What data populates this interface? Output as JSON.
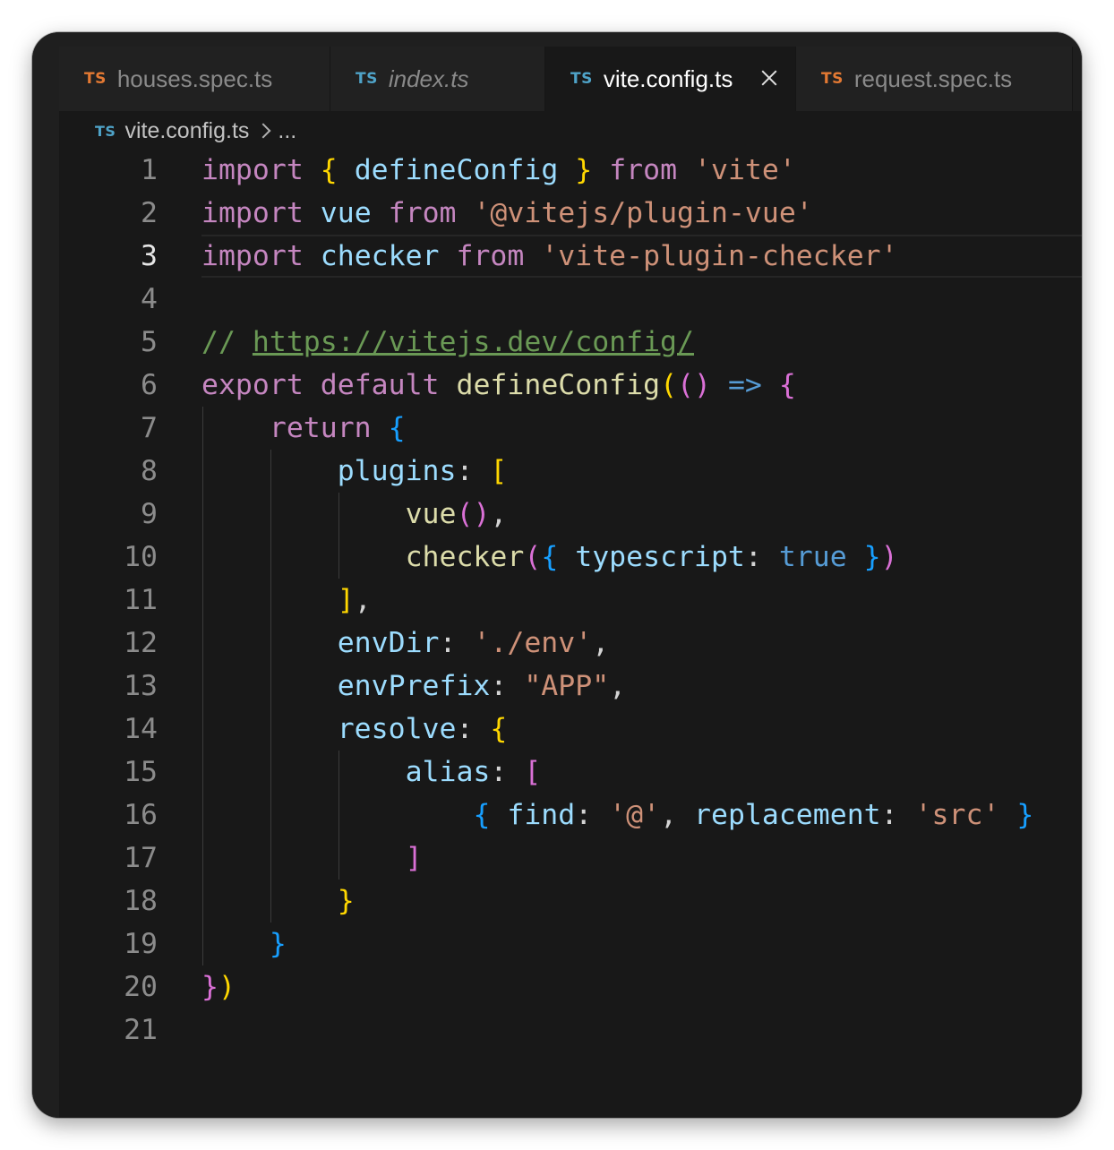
{
  "tabs": [
    {
      "badge": "TS",
      "label": "houses.spec.ts",
      "badge_color": "#e37933",
      "active": false,
      "italic": false
    },
    {
      "badge": "TS",
      "label": "index.ts",
      "badge_color": "#4fa3c8",
      "active": false,
      "italic": true
    },
    {
      "badge": "TS",
      "label": "vite.config.ts",
      "badge_color": "#4fa3c8",
      "active": true,
      "italic": false
    },
    {
      "badge": "TS",
      "label": "request.spec.ts",
      "badge_color": "#e37933",
      "active": false,
      "italic": false
    }
  ],
  "breadcrumb": {
    "badge": "TS",
    "file": "vite.config.ts",
    "more": "..."
  },
  "editor": {
    "current_line": 3,
    "line_numbers": [
      "1",
      "2",
      "3",
      "4",
      "5",
      "6",
      "7",
      "8",
      "9",
      "10",
      "11",
      "12",
      "13",
      "14",
      "15",
      "16",
      "17",
      "18",
      "19",
      "20",
      "21"
    ],
    "lines": [
      [
        [
          "kw",
          "import"
        ],
        [
          "pn",
          " "
        ],
        [
          "b1",
          "{"
        ],
        [
          "pn",
          " "
        ],
        [
          "vr",
          "defineConfig"
        ],
        [
          "pn",
          " "
        ],
        [
          "b1",
          "}"
        ],
        [
          "pn",
          " "
        ],
        [
          "kw",
          "from"
        ],
        [
          "pn",
          " "
        ],
        [
          "st",
          "'vite'"
        ]
      ],
      [
        [
          "kw",
          "import"
        ],
        [
          "pn",
          " "
        ],
        [
          "vr",
          "vue"
        ],
        [
          "pn",
          " "
        ],
        [
          "kw",
          "from"
        ],
        [
          "pn",
          " "
        ],
        [
          "st",
          "'@vitejs/plugin-vue'"
        ]
      ],
      [
        [
          "kw",
          "import"
        ],
        [
          "pn",
          " "
        ],
        [
          "vr",
          "checker"
        ],
        [
          "pn",
          " "
        ],
        [
          "kw",
          "from"
        ],
        [
          "pn",
          " "
        ],
        [
          "st",
          "'vite-plugin-checker'"
        ]
      ],
      [],
      [
        [
          "cm",
          "// "
        ],
        [
          "url",
          "https://vitejs.dev/config/"
        ]
      ],
      [
        [
          "kw",
          "export"
        ],
        [
          "pn",
          " "
        ],
        [
          "kw",
          "default"
        ],
        [
          "pn",
          " "
        ],
        [
          "fn",
          "defineConfig"
        ],
        [
          "b1",
          "("
        ],
        [
          "b2",
          "()"
        ],
        [
          "pn",
          " "
        ],
        [
          "bl",
          "=>"
        ],
        [
          "pn",
          " "
        ],
        [
          "b2",
          "{"
        ]
      ],
      [
        [
          "pn",
          "    "
        ],
        [
          "kw",
          "return"
        ],
        [
          "pn",
          " "
        ],
        [
          "b3",
          "{"
        ]
      ],
      [
        [
          "pn",
          "        "
        ],
        [
          "vr",
          "plugins"
        ],
        [
          "pn",
          ": "
        ],
        [
          "b1",
          "["
        ]
      ],
      [
        [
          "pn",
          "            "
        ],
        [
          "fn",
          "vue"
        ],
        [
          "b2",
          "()"
        ],
        [
          "pn",
          ","
        ]
      ],
      [
        [
          "pn",
          "            "
        ],
        [
          "fn",
          "checker"
        ],
        [
          "b2",
          "("
        ],
        [
          "b3",
          "{"
        ],
        [
          "pn",
          " "
        ],
        [
          "vr",
          "typescript"
        ],
        [
          "pn",
          ": "
        ],
        [
          "bl",
          "true"
        ],
        [
          "pn",
          " "
        ],
        [
          "b3",
          "}"
        ],
        [
          "b2",
          ")"
        ]
      ],
      [
        [
          "pn",
          "        "
        ],
        [
          "b1",
          "]"
        ],
        [
          "pn",
          ","
        ]
      ],
      [
        [
          "pn",
          "        "
        ],
        [
          "vr",
          "envDir"
        ],
        [
          "pn",
          ": "
        ],
        [
          "st",
          "'./env'"
        ],
        [
          "pn",
          ","
        ]
      ],
      [
        [
          "pn",
          "        "
        ],
        [
          "vr",
          "envPrefix"
        ],
        [
          "pn",
          ": "
        ],
        [
          "st",
          "\"APP\""
        ],
        [
          "pn",
          ","
        ]
      ],
      [
        [
          "pn",
          "        "
        ],
        [
          "vr",
          "resolve"
        ],
        [
          "pn",
          ": "
        ],
        [
          "b1",
          "{"
        ]
      ],
      [
        [
          "pn",
          "            "
        ],
        [
          "vr",
          "alias"
        ],
        [
          "pn",
          ": "
        ],
        [
          "b2",
          "["
        ]
      ],
      [
        [
          "pn",
          "                "
        ],
        [
          "b3",
          "{"
        ],
        [
          "pn",
          " "
        ],
        [
          "vr",
          "find"
        ],
        [
          "pn",
          ": "
        ],
        [
          "st",
          "'@'"
        ],
        [
          "pn",
          ", "
        ],
        [
          "vr",
          "replacement"
        ],
        [
          "pn",
          ": "
        ],
        [
          "st",
          "'src'"
        ],
        [
          "pn",
          " "
        ],
        [
          "b3",
          "}"
        ]
      ],
      [
        [
          "pn",
          "            "
        ],
        [
          "b2",
          "]"
        ]
      ],
      [
        [
          "pn",
          "        "
        ],
        [
          "b1",
          "}"
        ]
      ],
      [
        [
          "pn",
          "    "
        ],
        [
          "b3",
          "}"
        ]
      ],
      [
        [
          "b2",
          "}"
        ],
        [
          "b1",
          ")"
        ]
      ],
      []
    ]
  }
}
